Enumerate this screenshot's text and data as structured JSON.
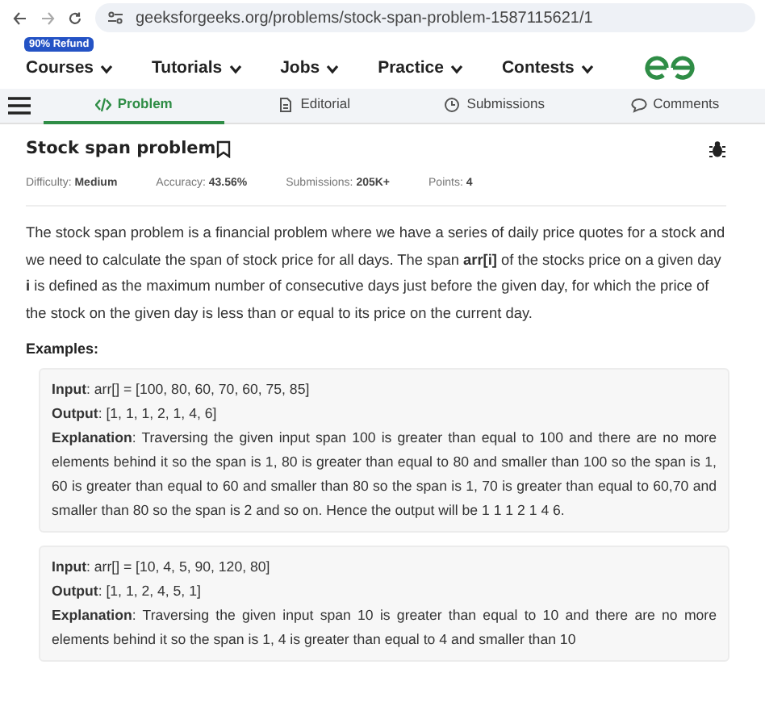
{
  "browser": {
    "url": "geeksforgeeks.org/problems/stock-span-problem-1587115621/1"
  },
  "nav": {
    "badge": "90% Refund",
    "items": [
      {
        "label": "Courses"
      },
      {
        "label": "Tutorials"
      },
      {
        "label": "Jobs"
      },
      {
        "label": "Practice"
      },
      {
        "label": "Contests"
      }
    ]
  },
  "tabs": [
    {
      "label": "Problem",
      "selected": true,
      "kind": "code"
    },
    {
      "label": "Editorial",
      "selected": false,
      "kind": "doc"
    },
    {
      "label": "Submissions",
      "selected": false,
      "kind": "clock"
    },
    {
      "label": "Comments",
      "selected": false,
      "kind": "chat"
    }
  ],
  "problem": {
    "title": "Stock span problem",
    "meta": [
      {
        "label": "Difficulty: ",
        "value": "Medium"
      },
      {
        "label": "Accuracy: ",
        "value": "43.56%"
      },
      {
        "label": "Submissions: ",
        "value": "205K+"
      },
      {
        "label": "Points: ",
        "value": "4"
      }
    ],
    "description": "The stock span problem is a financial problem where we have a series of daily price quotes for a stock and we need to calculate the span of stock price for all days. The span **arr[i]** of the stocks price on a given day **i** is defined as the maximum number of consecutive days just before the given day, for which the price of the stock on the given day is less than or equal to its price on the current day.",
    "examples_heading": "Examples:",
    "examples": [
      {
        "lines": [
          "**Input**: arr[] = [100, 80, 60, 70, 60, 75, 85]",
          "**Output**: [1, 1, 1, 2, 1, 4, 6]",
          "**Explanation**: Traversing the given input span 100 is greater than equal to 100 and there are no more elements behind it so the span is 1, 80 is greater than equal to 80 and smaller than 100 so the span is 1, 60 is greater than equal to 60 and smaller than 80 so the span is 1, 70 is greater than equal to 60,70 and smaller than 80 so the span is 2 and so on. Hence the output will be 1 1 1 2 1 4 6."
        ]
      },
      {
        "lines": [
          "**Input**: arr[] = [10, 4, 5, 90, 120, 80]",
          "**Output**: [1, 1, 2, 4, 5, 1]",
          "**Explanation**: Traversing the given input span 10 is greater than equal to 10 and there are no more elements behind it so the span is 1, 4 is greater than equal to 4 and smaller than 10"
        ]
      }
    ]
  }
}
